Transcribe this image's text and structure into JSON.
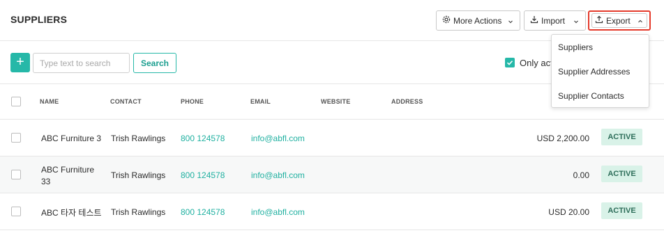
{
  "page": {
    "title": "SUPPLIERS"
  },
  "header": {
    "more_actions_label": "More Actions",
    "import_label": "Import",
    "export_label": "Export"
  },
  "export_menu": {
    "items": [
      "Suppliers",
      "Supplier Addresses",
      "Supplier Contacts"
    ]
  },
  "toolbar": {
    "add_label": "+",
    "search_placeholder": "Type text to search",
    "search_value": "",
    "search_button": "Search",
    "only_active_label": "Only act",
    "only_active_checked": true
  },
  "table": {
    "columns": [
      "NAME",
      "CONTACT",
      "PHONE",
      "EMAIL",
      "WEBSITE",
      "ADDRESS"
    ],
    "rows": [
      {
        "name": "ABC Furniture 3",
        "contact": "Trish Rawlings",
        "phone": "800 124578",
        "email": "info@abfl.com",
        "website": "",
        "address": "",
        "amount": "USD 2,200.00",
        "status": "ACTIVE"
      },
      {
        "name": "ABC Furniture 33",
        "contact": "Trish Rawlings",
        "phone": "800 124578",
        "email": "info@abfl.com",
        "website": "",
        "address": "",
        "amount": "0.00",
        "status": "ACTIVE"
      },
      {
        "name": "ABC 타자 테스트",
        "contact": "Trish Rawlings",
        "phone": "800 124578",
        "email": "info@abfl.com",
        "website": "",
        "address": "",
        "amount": "USD 20.00",
        "status": "ACTIVE"
      }
    ]
  },
  "colors": {
    "accent": "#26b8a8",
    "highlight": "#e53a2b",
    "badge_bg": "#d9f2e8",
    "link": "#1fb0a0"
  }
}
